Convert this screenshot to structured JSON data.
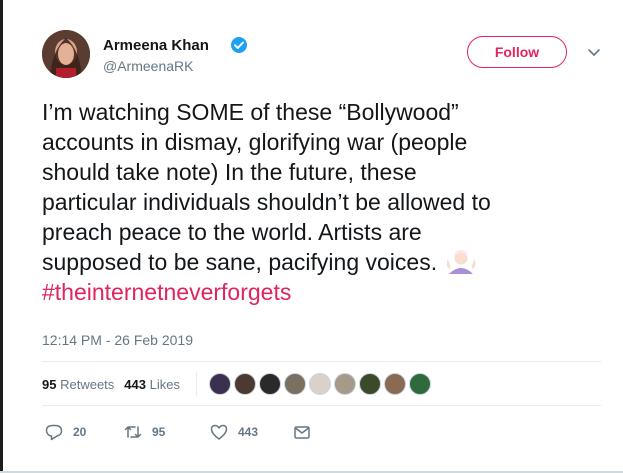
{
  "author": {
    "name": "Armeena Khan",
    "handle": "@ArmeenaRK",
    "verified": true
  },
  "follow_label": "Follow",
  "tweet": {
    "lines": [
      "I’m watching SOME of these “Bollywood”",
      "accounts in dismay, glorifying war (people",
      "should take note) In the future, these",
      "particular individuals shouldn’t be allowed to",
      "preach peace to the world. Artists are",
      "supposed to be sane, pacifying voices."
    ],
    "emoji": "woman-shrugging",
    "hashtag": "#theinternetneverforgets"
  },
  "timestamp": "12:14 PM - 26 Feb 2019",
  "stats": {
    "retweets_count": "95",
    "retweets_label": "Retweets",
    "likes_count": "443",
    "likes_label": "Likes"
  },
  "liker_avatar_colors": [
    "#3b3050",
    "#4a3a32",
    "#2a2a2a",
    "#7a7060",
    "#d8d2c8",
    "#a89a88",
    "#3d4a2a",
    "#8a6a55",
    "#2f6b3a"
  ],
  "actions": {
    "reply_count": "20",
    "retweet_count": "95",
    "like_count": "443"
  },
  "colors": {
    "accent": "#e0245e",
    "verified": "#1da1f2",
    "muted": "#657786"
  }
}
